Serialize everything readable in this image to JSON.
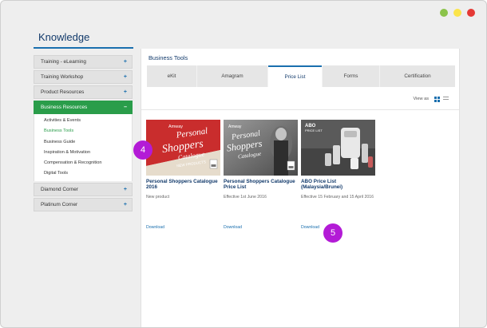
{
  "window": {
    "dot_colors": [
      "#8bc34a",
      "#ffeb3b",
      "#e53935"
    ]
  },
  "page": {
    "title": "Knowledge"
  },
  "sidebar": {
    "items": [
      {
        "label": "Training - eLearning",
        "toggle": "+"
      },
      {
        "label": "Training Workshop",
        "toggle": "+"
      },
      {
        "label": "Product Resources",
        "toggle": "+"
      },
      {
        "label": "Business Resources",
        "toggle": "–"
      },
      {
        "label": "Diamond Corner",
        "toggle": "+"
      },
      {
        "label": "Platinum Corner",
        "toggle": "+"
      }
    ],
    "sub_items": [
      "Activities & Events",
      "Business Tools",
      "Business Guide",
      "Inspiration & Motivation",
      "Compensation & Recognition",
      "Digital Tools"
    ]
  },
  "main": {
    "title": "Business Tools",
    "tabs": [
      "eKit",
      "Amagram",
      "Price List",
      "Forms",
      "Certification"
    ],
    "view_label": "View as",
    "products": [
      {
        "title": "Personal Shoppers Catalogue 2016",
        "description": "New product",
        "link": "Download",
        "thumb_text": [
          "Amway",
          "Personal",
          "Shoppers",
          "Catalogue",
          "NEW PRODUCTS"
        ]
      },
      {
        "title": "Personal Shoppers Catalogue Price List",
        "description": "Effective 1st June 2016",
        "link": "Download",
        "thumb_text": [
          "Amway",
          "Personal",
          "Shoppers",
          "Catalogue"
        ]
      },
      {
        "title": "ABO Price List (Malaysia/Brunei)",
        "description": "Effective 15 February and 15 April 2016",
        "link": "Download",
        "thumb_text": [
          "ABO",
          "PRICE LIST"
        ]
      }
    ]
  },
  "callouts": [
    "4",
    "5"
  ]
}
